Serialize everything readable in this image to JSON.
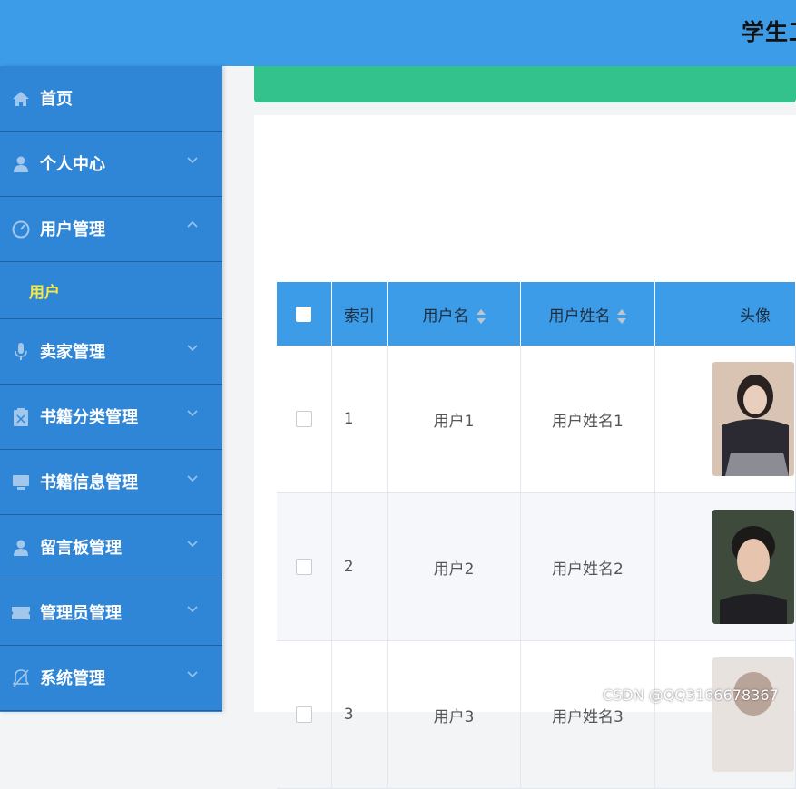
{
  "header": {
    "title": "学生工"
  },
  "sidebar": {
    "items": [
      {
        "label": "首页",
        "icon": "home-icon",
        "arrow": ""
      },
      {
        "label": "个人中心",
        "icon": "user-icon",
        "arrow": "down"
      },
      {
        "label": "用户管理",
        "icon": "gauge-icon",
        "arrow": "up"
      },
      {
        "label": "卖家管理",
        "icon": "microphone-icon",
        "arrow": "down"
      },
      {
        "label": "书籍分类管理",
        "icon": "clipboard-icon",
        "arrow": "down"
      },
      {
        "label": "书籍信息管理",
        "icon": "monitor-icon",
        "arrow": "down"
      },
      {
        "label": "留言板管理",
        "icon": "user-icon",
        "arrow": "down"
      },
      {
        "label": "管理员管理",
        "icon": "ticket-icon",
        "arrow": "down"
      },
      {
        "label": "系统管理",
        "icon": "bell-off-icon",
        "arrow": "down"
      }
    ],
    "submenu": {
      "label": "用户"
    }
  },
  "table": {
    "columns": [
      "索引",
      "用户名",
      "用户姓名",
      "头像"
    ],
    "rows": [
      {
        "index": "1",
        "username": "用户1",
        "name": "用户姓名1"
      },
      {
        "index": "2",
        "username": "用户2",
        "name": "用户姓名2"
      },
      {
        "index": "3",
        "username": "用户3",
        "name": "用户姓名3"
      }
    ]
  },
  "colors": {
    "header": "#3d9ce8",
    "sidebar": "#2f86d6",
    "active_submenu": "#f5e94a",
    "green_bar": "#33c28c"
  },
  "watermark": "CSDN @QQ3166678367"
}
